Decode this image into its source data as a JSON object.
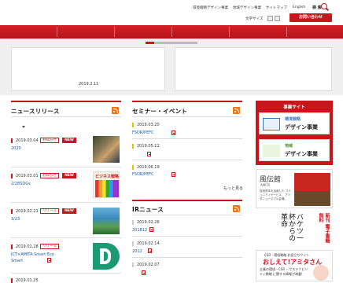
{
  "header": {
    "top_links": [
      "環境戦略デザイン事業",
      "地域デザイン事業",
      "サイトマップ",
      "English"
    ],
    "search_label": "検 索",
    "font_size_label": "文字サイズ",
    "contact_label": "お問い合わせ"
  },
  "carousel": {
    "date": "2019.2.11"
  },
  "news": {
    "title": "ニュースリリース",
    "items": [
      {
        "date": "2019.03.04",
        "tag": "お知らせ",
        "new": "NEW",
        "link": "2020"
      },
      {
        "date": "2019.03.01",
        "tag": "お知らせ",
        "new": "NEW",
        "link": "2/28SDGs",
        "thumb_caption": "ビジネス戦略"
      },
      {
        "date": "2019.02.21",
        "tag": "リリース",
        "new": "NEW",
        "link": "3/23"
      },
      {
        "date": "2019.01.28",
        "tag": "リリース",
        "new": "",
        "link": "ICT×AMITA Smart Eco",
        "link2": "Smart"
      },
      {
        "date": "2019.01.25",
        "tag": "",
        "new": "",
        "link": ""
      }
    ]
  },
  "events": {
    "title": "セミナー・イベント",
    "items": [
      {
        "date": "2019.03.20",
        "link": "FSOR/PEFC"
      },
      {
        "date": "2019.05.12",
        "link": ""
      },
      {
        "date": "2019.06.19",
        "link": "FSOR/PEFC"
      }
    ],
    "more": "もっと見る"
  },
  "ir": {
    "title": "IRニュース",
    "items": [
      {
        "date": "2019.02.26",
        "link": "201812"
      },
      {
        "date": "2019.02.14",
        "link": "2012"
      },
      {
        "date": "2019.02.07",
        "link": ""
      }
    ]
  },
  "side": {
    "business_title": "事業サイト",
    "banner1_small": "環境戦略",
    "banner1_big": "デザイン事業",
    "banner2_small": "地域",
    "banner2_big": "デザイン事業",
    "fuka_title": "風伝館",
    "fuka_sub": "AMITA",
    "fuka_desc": "自然資本を活用した コミュニティサービス、 アミタニュースプル会場。",
    "book_title": "バケツ一杯からの革命",
    "book_side": "新刊 電子書籍 無料",
    "csr_title": "CSR・環境戦略 お役立ちサイト",
    "csr_name": "おしえて!アミタさん",
    "csr_desc": "企業の環境・CSR・ サステナビリティ戦略 に関する情報が満載!"
  }
}
